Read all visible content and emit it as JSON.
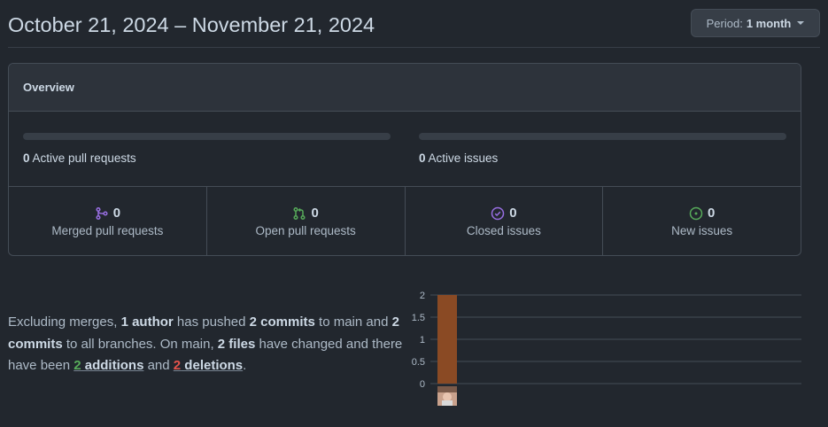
{
  "header": {
    "date_range": "October 21, 2024 – November 21, 2024",
    "period_label": "Period:",
    "period_value": "1 month"
  },
  "overview": {
    "title": "Overview",
    "active_prs": {
      "count": "0",
      "label": "Active pull requests",
      "fraction": 0
    },
    "active_issues": {
      "count": "0",
      "label": "Active issues",
      "fraction": 0
    },
    "stats": [
      {
        "count": "0",
        "label": "Merged pull requests",
        "icon": "git-merge-icon",
        "color": "#986ee2"
      },
      {
        "count": "0",
        "label": "Open pull requests",
        "icon": "git-pull-request-icon",
        "color": "#57ab5a"
      },
      {
        "count": "0",
        "label": "Closed issues",
        "icon": "issue-closed-icon",
        "color": "#986ee2"
      },
      {
        "count": "0",
        "label": "New issues",
        "icon": "issue-opened-icon",
        "color": "#57ab5a"
      }
    ]
  },
  "summary": {
    "p1": "Excluding merges, ",
    "authors": "1 author",
    "p2": " has pushed ",
    "commits_main": "2 commits",
    "p3": " to main and ",
    "commits_all": "2 commits",
    "p4": " to all branches. On main, ",
    "files": "2 files",
    "p5": " have changed and there have been ",
    "additions_num": "2",
    "additions_word": " additions",
    "p6": " and ",
    "deletions_num": "2",
    "deletions_word": " deletions",
    "p7": "."
  },
  "chart_data": {
    "type": "bar",
    "categories": [
      "author-1"
    ],
    "values": [
      2
    ],
    "ylim": [
      0,
      2
    ],
    "yticks": [
      "0",
      "0.5",
      "1",
      "1.5",
      "2"
    ],
    "grid": true,
    "bar_color": "#8a4a24",
    "category_labels": "avatar"
  }
}
